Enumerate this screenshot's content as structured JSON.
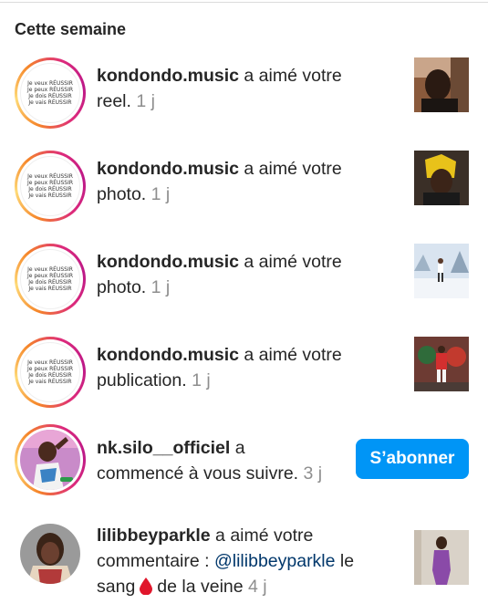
{
  "section": {
    "title": "Cette semaine"
  },
  "avatar_text": {
    "lines": [
      "Je veux RÉUSSIR",
      "Je peux RÉUSSIR",
      "Je dois RÉUSSIR",
      "Je vais RÉUSSIR"
    ]
  },
  "notifications": [
    {
      "user": "kondondo.music",
      "action": " a aimé votre",
      "action2": "reel.",
      "time": "1 j"
    },
    {
      "user": "kondondo.music",
      "action": " a aimé votre",
      "action2": "photo.",
      "time": "1 j"
    },
    {
      "user": "kondondo.music",
      "action": " a aimé votre",
      "action2": "photo.",
      "time": "1 j"
    },
    {
      "user": "kondondo.music",
      "action": " a aimé votre",
      "action2": "publication.",
      "time": "1 j"
    },
    {
      "user": "nk.silo__officiel",
      "action": " a",
      "action2": "commencé à vous suivre.",
      "time": "3 j",
      "button": "S’abonner"
    },
    {
      "user": "lilibbeyparkle",
      "action": " a aimé votre",
      "action2": "commentaire :",
      "mention": "@lilibbeyparkle",
      "action3": " le",
      "action4": "sang",
      "action5": "de la veine",
      "time": "4 j"
    }
  ],
  "icons": {
    "drop": "blood-drop-icon"
  },
  "colors": {
    "follow_button": "#0095f6",
    "timestamp": "#8e8e8e",
    "mention": "#00376b"
  }
}
